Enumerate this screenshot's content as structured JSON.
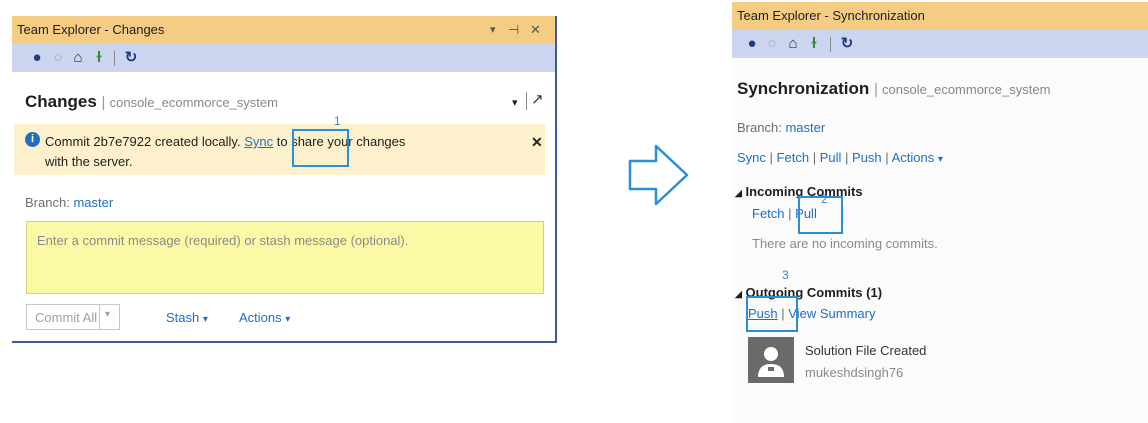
{
  "left": {
    "title": "Team Explorer - Changes",
    "title_controls": [
      "▾",
      "⊣",
      "✕"
    ],
    "page_name": "Changes",
    "repo": "console_ecommorce_system",
    "notice": {
      "prefix": "Commit 2b7e7922 created locally.",
      "sync_link": "Sync",
      "suffix_line1": "to share your changes",
      "suffix_line2": "with the server.",
      "close": "✕"
    },
    "branch_label": "Branch:",
    "branch_value": "master",
    "commit_placeholder": "Enter a commit message (required) or stash message (optional).",
    "commit_all": "Commit All",
    "stash": "Stash",
    "actions": "Actions",
    "dropdown_caret": "▾",
    "marker": "1"
  },
  "right": {
    "title": "Team Explorer - Synchronization",
    "page_name": "Synchronization",
    "repo": "console_ecommorce_system",
    "branch_label": "Branch:",
    "branch_value": "master",
    "nav": {
      "sync": "Sync",
      "fetch": "Fetch",
      "pull": "Pull",
      "push": "Push",
      "actions": "Actions"
    },
    "incoming": {
      "header": "Incoming Commits",
      "fetch": "Fetch",
      "pull": "Pull",
      "empty": "There are no incoming commits."
    },
    "outgoing": {
      "header": "Outgoing Commits (1)",
      "push": "Push",
      "view_summary": "View Summary",
      "commit_title": "Solution File Created",
      "commit_author": "mukeshdsingh76"
    },
    "markers": [
      "2",
      "3"
    ]
  },
  "colors": {
    "title_bg": "#f5cc84",
    "toolbar_bg": "#ccd5f0",
    "link": "#1e6fc1",
    "highlight": "#2a8fd6",
    "notice_bg": "#fdf0cc",
    "commit_box_bg": "#fbf9a6"
  }
}
